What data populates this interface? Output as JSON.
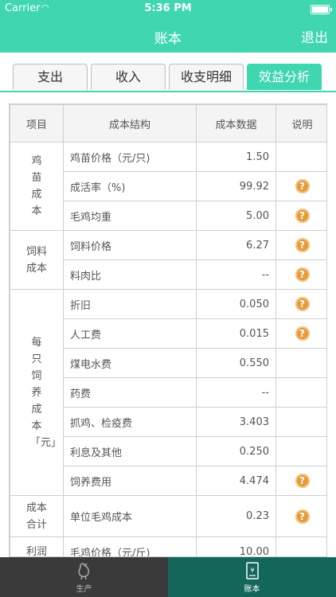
{
  "status": {
    "carrier": "Carrier",
    "time": "5:36 PM"
  },
  "nav": {
    "title": "账本",
    "exit": "退出"
  },
  "tabs": [
    "支出",
    "收入",
    "收支明细",
    "效益分析"
  ],
  "table": {
    "headers": [
      "项目",
      "成本结构",
      "成本数据",
      "说明"
    ],
    "groups": [
      "鸡苗成本",
      "饲料成本",
      "每只饲养成本「元」",
      "成本合计",
      "利润"
    ],
    "rows": [
      {
        "item": "鸡苗价格（元/只)",
        "value": "1.50"
      },
      {
        "item": "成活率（%)",
        "value": "99.92"
      },
      {
        "item": "毛鸡均重",
        "value": "5.00"
      },
      {
        "item": "饲料价格",
        "value": "6.27"
      },
      {
        "item": "料肉比",
        "value": "--"
      },
      {
        "item": "折旧",
        "value": "0.050"
      },
      {
        "item": "人工费",
        "value": "0.015"
      },
      {
        "item": "煤电水费",
        "value": "0.550"
      },
      {
        "item": "药费",
        "value": "--"
      },
      {
        "item": "抓鸡、检疫费",
        "value": "3.403"
      },
      {
        "item": "利息及其他",
        "value": "0.250"
      },
      {
        "item": "饲养费用",
        "value": "4.474"
      },
      {
        "item": "单位毛鸡成本",
        "value": "0.23"
      },
      {
        "item": "毛鸡价格（元/斤)",
        "value": "10.00"
      }
    ],
    "help_glyph": "?"
  },
  "tabbar": {
    "items": [
      "生产",
      "账本"
    ],
    "icons": [
      "chicken-icon",
      "ledger-icon"
    ]
  },
  "colors": {
    "accent": "#3fd6b0",
    "active_tab_bar": "#12665a",
    "help_icon": "#e69b3a"
  }
}
